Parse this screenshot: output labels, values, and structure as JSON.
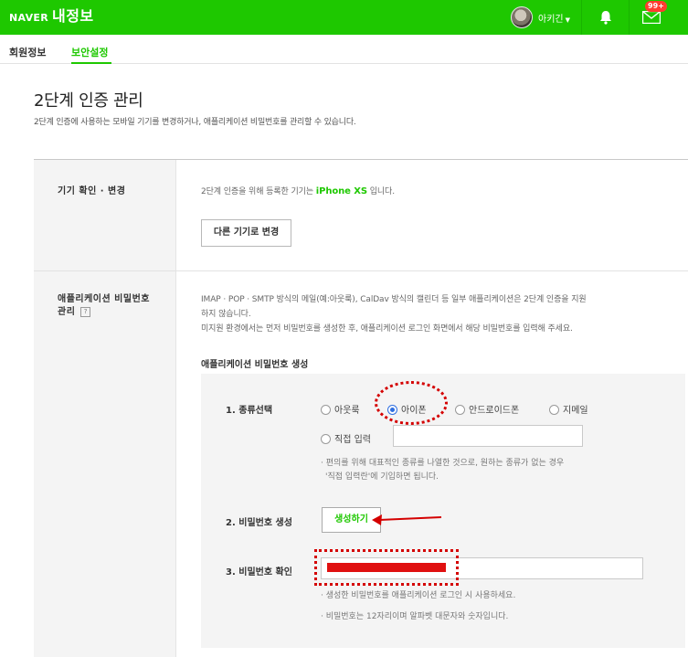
{
  "header": {
    "brand": "NAVER",
    "title": "내정보",
    "username": "아키긴",
    "mail_badge": "99+",
    "bg_color": "#1ec800"
  },
  "subnav": {
    "tabs": [
      {
        "label": "회원정보",
        "active": false
      },
      {
        "label": "보안설정",
        "active": true
      }
    ]
  },
  "page": {
    "title": "2단계 인증 관리",
    "description": "2단계 인증에 사용하는 모바일 기기를 변경하거나, 애플리케이션 비밀번호를 관리할 수 있습니다."
  },
  "device_section": {
    "label": "기기 확인 · 변경",
    "text_before": "2단계 인증을 위해 등록한 기기는 ",
    "device_name": "iPhone XS",
    "text_after": " 입니다.",
    "change_button": "다른 기기로 변경"
  },
  "app_password_section": {
    "label_line1": "애플리케이션 비밀번호",
    "label_line2": "관리",
    "help_icon": "?",
    "desc_line1": "IMAP · POP · SMTP 방식의 메일(예:아웃룩), CalDav 방식의 캘린더 등 일부 애플리케이션은 2단계 인증을 지원",
    "desc_line2": "하지 않습니다.",
    "desc_line3": "미지원 환경에서는 먼저 비밀번호를 생성한 후, 애플리케이션 로그인 화면에서 해당 비밀번호를 입력해 주세요.",
    "subheading": "애플리케이션 비밀번호 생성",
    "step1_label": "1. 종류선택",
    "radio_options": [
      {
        "label": "아웃룩",
        "checked": false
      },
      {
        "label": "아이폰",
        "checked": true
      },
      {
        "label": "안드로이드폰",
        "checked": false
      },
      {
        "label": "지메일",
        "checked": false
      },
      {
        "label": "직접 입력",
        "checked": false
      }
    ],
    "direct_input_value": "",
    "type_note_line1": "· 편의를 위해 대표적인 종류를 나열한 것으로, 원하는 종류가 없는 경우",
    "type_note_line2": "'직접 입력란'에 기입하면 됩니다.",
    "step2_label": "2. 비밀번호 생성",
    "generate_button": "생성하기",
    "step3_label": "3. 비밀번호 확인",
    "password_note1": "· 생성한 비밀번호를 애플리케이션 로그인 시 사용하세요.",
    "password_note2": "· 비밀번호는 12자리이며 알파벳 대문자와 숫자입니다."
  },
  "annotation_color": "#d40000"
}
